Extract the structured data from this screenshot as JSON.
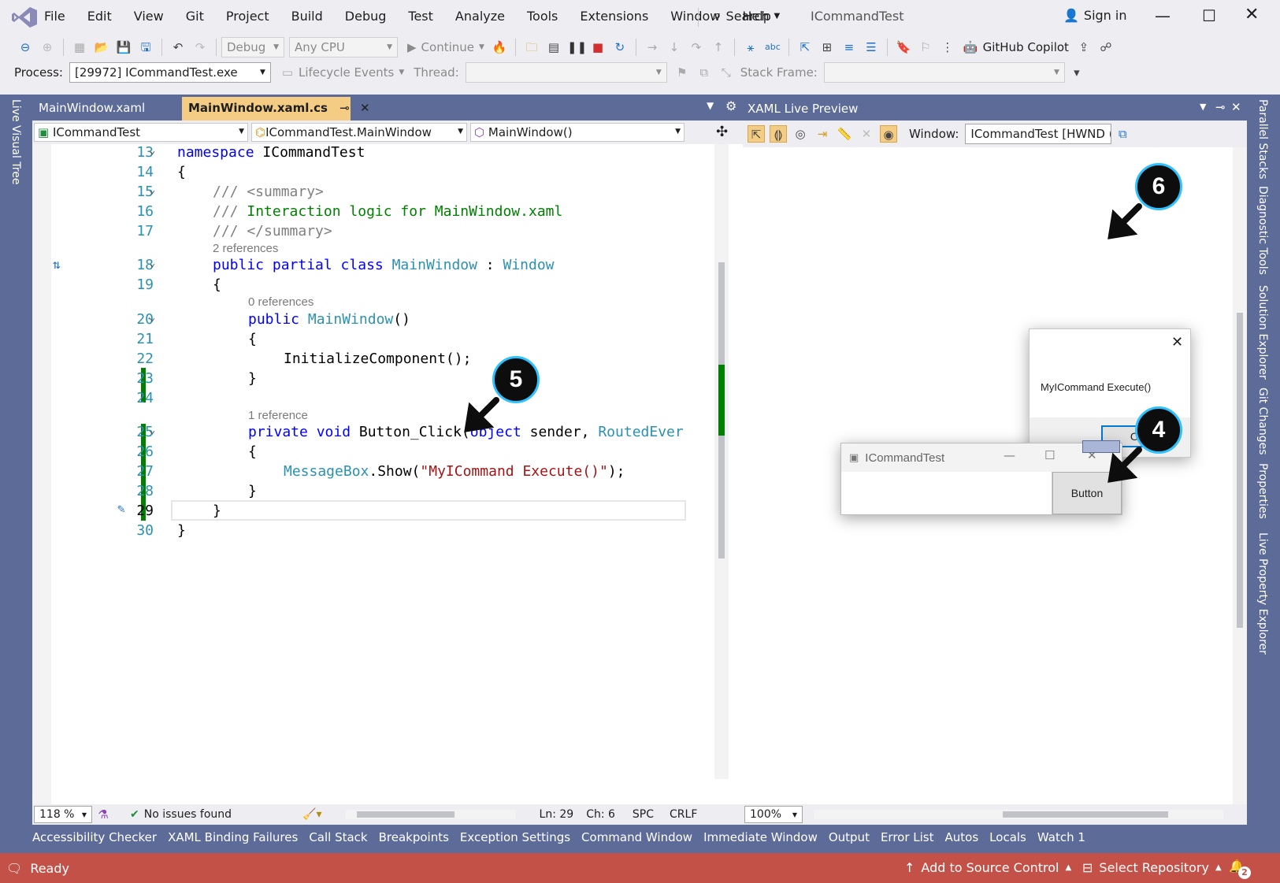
{
  "menu": [
    "File",
    "Edit",
    "View",
    "Git",
    "Project",
    "Build",
    "Debug",
    "Test",
    "Analyze",
    "Tools",
    "Extensions",
    "Window",
    "Help"
  ],
  "search_label": "Search",
  "solution_title": "ICommandTest",
  "sign_in": "Sign in",
  "toolbar": {
    "config": "Debug",
    "platform": "Any CPU",
    "continue": "Continue",
    "copilot": "GitHub Copilot",
    "process_label": "Process:",
    "process_value": "[29972] ICommandTest.exe",
    "lifecycle": "Lifecycle Events",
    "thread_label": "Thread:",
    "stack_label": "Stack Frame:"
  },
  "left_tool": "Live Visual Tree",
  "right_tools": [
    "Parallel Stacks",
    "Diagnostic Tools",
    "Solution Explorer",
    "Git Changes",
    "Properties",
    "Live Property Explorer"
  ],
  "tabs": [
    "MainWindow.xaml",
    "MainWindow.xaml.cs"
  ],
  "nav": {
    "project": "ICommandTest",
    "class": "ICommandTest.MainWindow",
    "member": "MainWindow()"
  },
  "code": {
    "line_numbers": [
      "13",
      "14",
      "15",
      "16",
      "17",
      "18",
      "19",
      "20",
      "21",
      "22",
      "23",
      "24",
      "25",
      "26",
      "27",
      "28",
      "29",
      "30"
    ],
    "ns_kw": "namespace",
    "ns_name": "ICommandTest",
    "summary_open": "/// <summary>",
    "summary_slash": "///",
    "summary_text": "Interaction logic for MainWindow.xaml",
    "summary_close": "/// </summary>",
    "refs2": "2 references",
    "refs0": "0 references",
    "refs1": "1 reference",
    "class_kw": "public partial class",
    "class_name": "MainWindow",
    "colon": " : ",
    "base_name": "Window",
    "public_kw": "public",
    "ctor_name": "MainWindow",
    "ctor_parens": "()",
    "init_call": "InitializeComponent();",
    "priv_kw": "private void",
    "method_name": " Button_Click(",
    "obj_kw": "object",
    "sender": " sender, ",
    "routed": "RoutedEver",
    "msgbox": "MessageBox",
    "show": ".Show(",
    "string_lit": "\"MyICommand Execute()\"",
    "close_call": ");",
    "open_brace": "{",
    "close_brace": "}"
  },
  "editor_status": {
    "zoom": "118 %",
    "issues": "No issues found",
    "ln": "Ln: 29",
    "ch": "Ch: 6",
    "spc": "SPC",
    "crlf": "CRLF"
  },
  "preview": {
    "title": "XAML Live Preview",
    "window_label": "Window:",
    "window_value": "ICommandTest [HWND (",
    "zoom": "100%"
  },
  "msgbox": {
    "text": "MyICommand Execute()",
    "ok": "OK"
  },
  "app_window": {
    "title": "ICommandTest",
    "button": "Button"
  },
  "badges": [
    "4",
    "5",
    "6"
  ],
  "bottom_tabs": [
    "Accessibility Checker",
    "XAML Binding Failures",
    "Call Stack",
    "Breakpoints",
    "Exception Settings",
    "Command Window",
    "Immediate Window",
    "Output",
    "Error List",
    "Autos",
    "Locals",
    "Watch 1"
  ],
  "status": {
    "ready": "Ready",
    "source_control": "Add to Source Control",
    "repo": "Select Repository",
    "notif": "2"
  },
  "colors": {
    "status_bar": "#c35147",
    "frame": "#5d6b99",
    "active_tab": "#f5cc84",
    "badge_ring": "#2ec1ff",
    "change_bar": "#008000"
  }
}
